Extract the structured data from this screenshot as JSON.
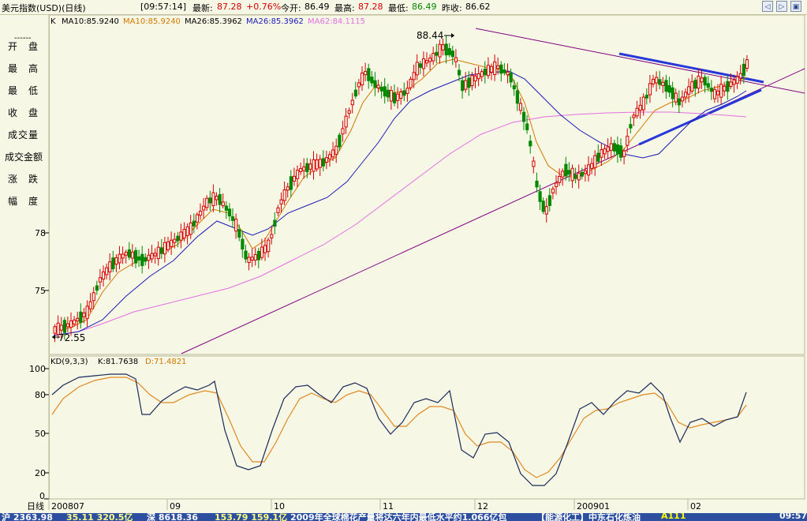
{
  "titlebar": {
    "symbol": "美元指数(USD)(日线)",
    "time": "[09:57:14]",
    "latest_label": "最新:",
    "latest_value": "87.28",
    "change_value": "+0.76%",
    "open_label": "今开:",
    "open_value": "86.49",
    "high_label": "最高:",
    "high_value": "87.28",
    "low_label": "最低:",
    "low_value": "86.49",
    "prev_label": "昨收:",
    "prev_value": "86.62"
  },
  "window_buttons": [
    "◁",
    "▷",
    "▣"
  ],
  "left_panel": {
    "separator": "------",
    "items": [
      "开　盘",
      "最　高",
      "最　低",
      "收　盘",
      "成交量",
      "成交金额",
      "涨　跌",
      "幅　度"
    ]
  },
  "main_chart": {
    "legend": [
      {
        "text": "K",
        "color": "#000000"
      },
      {
        "text": "MA10:85.9240",
        "color": "#000000"
      },
      {
        "text": "MA10:85.9240",
        "color": "#d27800"
      },
      {
        "text": "MA26:85.3962",
        "color": "#000000"
      },
      {
        "text": "MA26:85.3962",
        "color": "#1a1ab4"
      },
      {
        "text": "MA62:84.1115",
        "color": "#e070e0"
      }
    ],
    "high_label": "88.44",
    "low_label": "72.55",
    "price_ticks": [
      "78",
      "75"
    ]
  },
  "kd_chart": {
    "legend_name": "KD(9,3,3)",
    "legend_k": "K:81.7638",
    "legend_d": "D:71.4821",
    "ticks": [
      "100",
      "80",
      "50",
      "20",
      "0"
    ]
  },
  "x_axis": {
    "period": "日线",
    "labels": [
      "200807",
      "09",
      "10",
      "11",
      "12",
      "200901",
      "02"
    ]
  },
  "ticker": {
    "items": [
      {
        "text": "沪 2363.98",
        "color": "#ffffff"
      },
      {
        "text": "35.11 320.5亿",
        "color": "#ffff80"
      },
      {
        "text": "深 8618.36",
        "color": "#ffffff"
      },
      {
        "text": "153.79 159.1亿",
        "color": "#ffff80"
      },
      {
        "text": "2009年全球棉花产量将达六年内最低水平约1.066亿包",
        "color": "#ffffff"
      },
      {
        "text": "【能源化工】中东石化炼油",
        "color": "#ffffff"
      },
      {
        "text": "A111",
        "color": "#ffff00"
      },
      {
        "text": "09:57",
        "color": "#ffffff"
      }
    ]
  },
  "colors": {
    "up": "#d40000",
    "down": "#008800",
    "ma10": "#d27800",
    "ma26": "#1a1ab4",
    "ma62": "#e070e0",
    "trend": "#800080",
    "triangle": "#2838d8",
    "kd_k": "#1a2a5a",
    "kd_d": "#e08820"
  }
}
